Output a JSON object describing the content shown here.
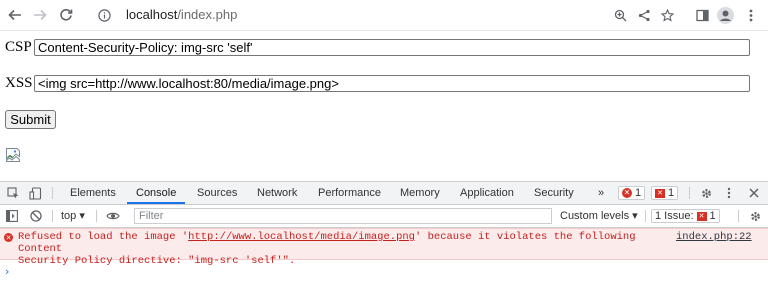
{
  "browser": {
    "url_host": "localhost",
    "url_path": "/index.php"
  },
  "form": {
    "csp_label": "CSP",
    "csp_value": "Content-Security-Policy: img-src 'self'",
    "xss_label": "XSS",
    "xss_value": "<img src=http://www.localhost:80/media/image.png>",
    "submit_label": "Submit"
  },
  "devtools": {
    "tabs": [
      {
        "label": "Elements",
        "active": false
      },
      {
        "label": "Console",
        "active": true
      },
      {
        "label": "Sources",
        "active": false
      },
      {
        "label": "Network",
        "active": false
      },
      {
        "label": "Performance",
        "active": false
      },
      {
        "label": "Memory",
        "active": false
      },
      {
        "label": "Application",
        "active": false
      },
      {
        "label": "Security",
        "active": false
      }
    ],
    "more_tabs": "»",
    "error_count": "1",
    "issue_flag_count": "1",
    "context": "top",
    "filter_placeholder": "Filter",
    "levels_label": "Custom levels",
    "issues_label": "1 Issue:",
    "issues_count": "1",
    "message": {
      "prefix": "Refused to load the image '",
      "url": "http://www.localhost/media/image.png",
      "suffix": "' because it violates the following Content\nSecurity Policy directive: \"img-src 'self'\".",
      "source": "index.php:22"
    },
    "prompt_symbol": "›"
  },
  "colors": {
    "accent": "#1a73e8",
    "error": "#d93025",
    "error_bg": "#fcebeb"
  }
}
